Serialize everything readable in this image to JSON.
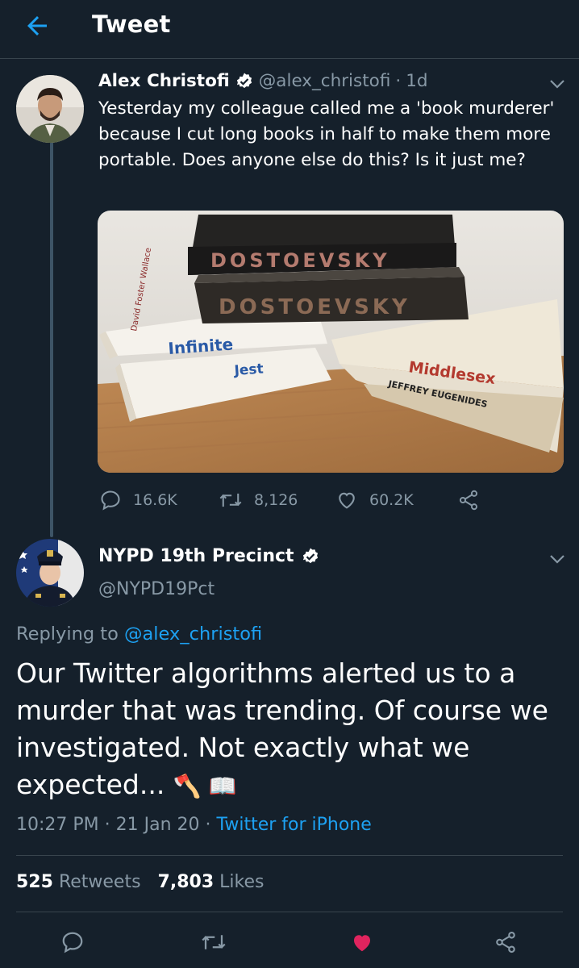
{
  "header": {
    "title": "Tweet"
  },
  "tweet1": {
    "name": "Alex Christofi",
    "handle": "@alex_christofi",
    "sep": "·",
    "age": "1d",
    "text": "Yesterday my colleague called me a 'book murderer' because I cut long books in half to make them more portable. Does anyone else do this? Is it just me?",
    "media_books": {
      "top_book": "DOSTOEVSKY",
      "middle_book": "DOSTOEVSKY",
      "left_title": "Infinite",
      "left_title2": "Jest",
      "left_author": "David Foster Wallace",
      "right_title": "Middlesex",
      "right_author": "JEFFREY EUGENIDES"
    },
    "counts": {
      "replies": "16.6K",
      "retweets": "8,126",
      "likes": "60.2K"
    }
  },
  "tweet2": {
    "name": "NYPD 19th Precinct",
    "handle": "@NYPD19Pct",
    "replying_prefix": "Replying to",
    "replying_handle": "@alex_christofi",
    "text": "Our Twitter algorithms alerted us to a murder that was trending. Of course we investigated. Not exactly what we expected...",
    "emojis": "🪓 📖",
    "time": "10:27 PM",
    "date": "21 Jan 20",
    "source": "Twitter for iPhone",
    "stats": {
      "retweets": "525",
      "retweets_label": "Retweets",
      "likes": "7,803",
      "likes_label": "Likes"
    }
  },
  "colors": {
    "background": "#15202b",
    "accent": "#1da1f2",
    "muted": "#8899a6",
    "like_active": "#e0245e",
    "divider": "#38444d"
  },
  "icons": {
    "back": "arrow-left-icon",
    "verified": "verified-badge-icon",
    "chevron": "chevron-down-icon",
    "reply": "reply-icon",
    "retweet": "retweet-icon",
    "like": "heart-icon",
    "share": "share-icon"
  }
}
